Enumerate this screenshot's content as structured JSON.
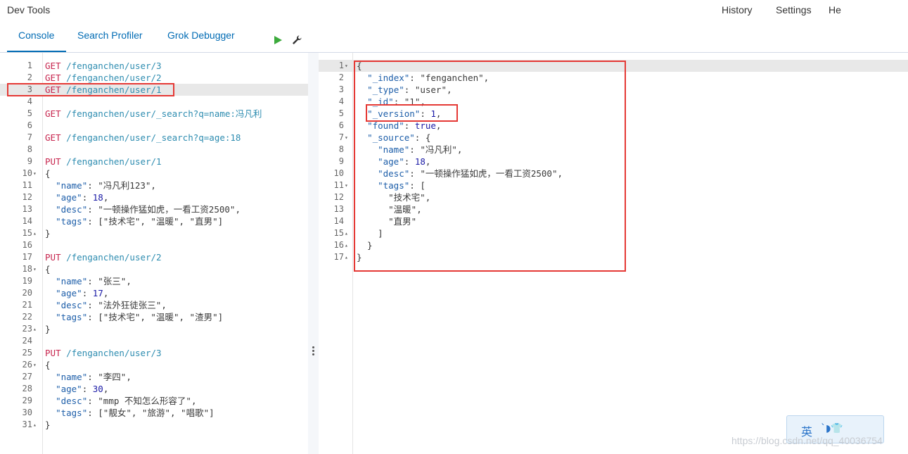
{
  "app_title": "Dev Tools",
  "top_nav": [
    "History",
    "Settings",
    "He"
  ],
  "tabs": [
    "Console",
    "Search Profiler",
    "Grok Debugger"
  ],
  "request_editor": {
    "lines": [
      {
        "n": "1",
        "fold": "",
        "tokens": [
          [
            "m",
            "GET"
          ],
          [
            "pn",
            " "
          ],
          [
            "p",
            "/fengancheen/user/3"
          ]
        ]
      },
      {
        "n": "2",
        "fold": "",
        "tokens": [
          [
            "m",
            "GET"
          ],
          [
            "pn",
            " "
          ],
          [
            "p",
            "/fenganchen/user/2"
          ]
        ]
      },
      {
        "n": "3",
        "fold": "",
        "tokens": [
          [
            "m",
            "GET"
          ],
          [
            "pn",
            " "
          ],
          [
            "p",
            "/fenganchen/user/1"
          ]
        ]
      },
      {
        "n": "4",
        "fold": "",
        "tokens": []
      },
      {
        "n": "5",
        "fold": "",
        "tokens": [
          [
            "m",
            "GET"
          ],
          [
            "pn",
            " "
          ],
          [
            "p",
            "/fenganchen/user/_search?q=name:冯凡利"
          ]
        ]
      },
      {
        "n": "6",
        "fold": "",
        "tokens": []
      },
      {
        "n": "7",
        "fold": "",
        "tokens": [
          [
            "m",
            "GET"
          ],
          [
            "pn",
            " "
          ],
          [
            "p",
            "/fenganchen/user/_search?q=age:18"
          ]
        ]
      },
      {
        "n": "8",
        "fold": "",
        "tokens": []
      },
      {
        "n": "9",
        "fold": "",
        "tokens": [
          [
            "m",
            "PUT"
          ],
          [
            "pn",
            " "
          ],
          [
            "p",
            "/fenganchen/user/1"
          ]
        ]
      },
      {
        "n": "10",
        "fold": "▾",
        "tokens": [
          [
            "pn",
            "{"
          ]
        ]
      },
      {
        "n": "11",
        "fold": "",
        "tokens": [
          [
            "pn",
            "  "
          ],
          [
            "k",
            "\"name\""
          ],
          [
            "pn",
            ": "
          ],
          [
            "s",
            "\"冯凡利123\""
          ],
          [
            "pn",
            ","
          ]
        ]
      },
      {
        "n": "12",
        "fold": "",
        "tokens": [
          [
            "pn",
            "  "
          ],
          [
            "k",
            "\"age\""
          ],
          [
            "pn",
            ": "
          ],
          [
            "n",
            "18"
          ],
          [
            "pn",
            ","
          ]
        ]
      },
      {
        "n": "13",
        "fold": "",
        "tokens": [
          [
            "pn",
            "  "
          ],
          [
            "k",
            "\"desc\""
          ],
          [
            "pn",
            ": "
          ],
          [
            "s",
            "\"一顿操作猛如虎，一看工资2500\""
          ],
          [
            "pn",
            ","
          ]
        ]
      },
      {
        "n": "14",
        "fold": "",
        "tokens": [
          [
            "pn",
            "  "
          ],
          [
            "k",
            "\"tags\""
          ],
          [
            "pn",
            ": ["
          ],
          [
            "s",
            "\"技术宅\""
          ],
          [
            "pn",
            ", "
          ],
          [
            "s",
            "\"温暖\""
          ],
          [
            "pn",
            ", "
          ],
          [
            "s",
            "\"直男\""
          ],
          [
            "pn",
            "]"
          ]
        ]
      },
      {
        "n": "15",
        "fold": "▴",
        "tokens": [
          [
            "pn",
            "}"
          ]
        ]
      },
      {
        "n": "16",
        "fold": "",
        "tokens": []
      },
      {
        "n": "17",
        "fold": "",
        "tokens": [
          [
            "m",
            "PUT"
          ],
          [
            "pn",
            " "
          ],
          [
            "p",
            "/fenganchen/user/2"
          ]
        ]
      },
      {
        "n": "18",
        "fold": "▾",
        "tokens": [
          [
            "pn",
            "{"
          ]
        ]
      },
      {
        "n": "19",
        "fold": "",
        "tokens": [
          [
            "pn",
            "  "
          ],
          [
            "k",
            "\"name\""
          ],
          [
            "pn",
            ": "
          ],
          [
            "s",
            "\"张三\""
          ],
          [
            "pn",
            ","
          ]
        ]
      },
      {
        "n": "20",
        "fold": "",
        "tokens": [
          [
            "pn",
            "  "
          ],
          [
            "k",
            "\"age\""
          ],
          [
            "pn",
            ": "
          ],
          [
            "n",
            "17"
          ],
          [
            "pn",
            ","
          ]
        ]
      },
      {
        "n": "21",
        "fold": "",
        "tokens": [
          [
            "pn",
            "  "
          ],
          [
            "k",
            "\"desc\""
          ],
          [
            "pn",
            ": "
          ],
          [
            "s",
            "\"法外狂徒张三\""
          ],
          [
            "pn",
            ","
          ]
        ]
      },
      {
        "n": "22",
        "fold": "",
        "tokens": [
          [
            "pn",
            "  "
          ],
          [
            "k",
            "\"tags\""
          ],
          [
            "pn",
            ": ["
          ],
          [
            "s",
            "\"技术宅\""
          ],
          [
            "pn",
            ", "
          ],
          [
            "s",
            "\"温暖\""
          ],
          [
            "pn",
            ", "
          ],
          [
            "s",
            "\"渣男\""
          ],
          [
            "pn",
            "]"
          ]
        ]
      },
      {
        "n": "23",
        "fold": "▴",
        "tokens": [
          [
            "pn",
            "}"
          ]
        ]
      },
      {
        "n": "24",
        "fold": "",
        "tokens": []
      },
      {
        "n": "25",
        "fold": "",
        "tokens": [
          [
            "m",
            "PUT"
          ],
          [
            "pn",
            " "
          ],
          [
            "p",
            "/fenganchen/user/3"
          ]
        ]
      },
      {
        "n": "26",
        "fold": "▾",
        "tokens": [
          [
            "pn",
            "{"
          ]
        ]
      },
      {
        "n": "27",
        "fold": "",
        "tokens": [
          [
            "pn",
            "  "
          ],
          [
            "k",
            "\"name\""
          ],
          [
            "pn",
            ": "
          ],
          [
            "s",
            "\"李四\""
          ],
          [
            "pn",
            ","
          ]
        ]
      },
      {
        "n": "28",
        "fold": "",
        "tokens": [
          [
            "pn",
            "  "
          ],
          [
            "k",
            "\"age\""
          ],
          [
            "pn",
            ": "
          ],
          [
            "n",
            "30"
          ],
          [
            "pn",
            ","
          ]
        ]
      },
      {
        "n": "29",
        "fold": "",
        "tokens": [
          [
            "pn",
            "  "
          ],
          [
            "k",
            "\"desc\""
          ],
          [
            "pn",
            ": "
          ],
          [
            "s",
            "\"mmp 不知怎么形容了\""
          ],
          [
            "pn",
            ","
          ]
        ]
      },
      {
        "n": "30",
        "fold": "",
        "tokens": [
          [
            "pn",
            "  "
          ],
          [
            "k",
            "\"tags\""
          ],
          [
            "pn",
            ": ["
          ],
          [
            "s",
            "\"靓女\""
          ],
          [
            "pn",
            ", "
          ],
          [
            "s",
            "\"旅游\""
          ],
          [
            "pn",
            ", "
          ],
          [
            "s",
            "\"唱歌\""
          ],
          [
            "pn",
            "]"
          ]
        ]
      },
      {
        "n": "31",
        "fold": "▴",
        "tokens": [
          [
            "pn",
            "}"
          ]
        ]
      }
    ]
  },
  "response_editor": {
    "lines": [
      {
        "n": "1",
        "fold": "▾",
        "tokens": [
          [
            "pn",
            "{"
          ]
        ]
      },
      {
        "n": "2",
        "fold": "",
        "tokens": [
          [
            "pn",
            "  "
          ],
          [
            "k",
            "\"_index\""
          ],
          [
            "pn",
            ": "
          ],
          [
            "s",
            "\"fenganchen\""
          ],
          [
            "pn",
            ","
          ]
        ]
      },
      {
        "n": "3",
        "fold": "",
        "tokens": [
          [
            "pn",
            "  "
          ],
          [
            "k",
            "\"_type\""
          ],
          [
            "pn",
            ": "
          ],
          [
            "s",
            "\"user\""
          ],
          [
            "pn",
            ","
          ]
        ]
      },
      {
        "n": "4",
        "fold": "",
        "tokens": [
          [
            "pn",
            "  "
          ],
          [
            "k",
            "\"_id\""
          ],
          [
            "pn",
            ": "
          ],
          [
            "s",
            "\"1\""
          ],
          [
            "pn",
            ","
          ]
        ]
      },
      {
        "n": "5",
        "fold": "",
        "tokens": [
          [
            "pn",
            "  "
          ],
          [
            "k",
            "\"_version\""
          ],
          [
            "pn",
            ": "
          ],
          [
            "n",
            "1"
          ],
          [
            "pn",
            ","
          ]
        ]
      },
      {
        "n": "6",
        "fold": "",
        "tokens": [
          [
            "pn",
            "  "
          ],
          [
            "k",
            "\"found\""
          ],
          [
            "pn",
            ": "
          ],
          [
            "b",
            "true"
          ],
          [
            "pn",
            ","
          ]
        ]
      },
      {
        "n": "7",
        "fold": "▾",
        "tokens": [
          [
            "pn",
            "  "
          ],
          [
            "k",
            "\"_source\""
          ],
          [
            "pn",
            ": {"
          ]
        ]
      },
      {
        "n": "8",
        "fold": "",
        "tokens": [
          [
            "pn",
            "    "
          ],
          [
            "k",
            "\"name\""
          ],
          [
            "pn",
            ": "
          ],
          [
            "s",
            "\"冯凡利\""
          ],
          [
            "pn",
            ","
          ]
        ]
      },
      {
        "n": "9",
        "fold": "",
        "tokens": [
          [
            "pn",
            "    "
          ],
          [
            "k",
            "\"age\""
          ],
          [
            "pn",
            ": "
          ],
          [
            "n",
            "18"
          ],
          [
            "pn",
            ","
          ]
        ]
      },
      {
        "n": "10",
        "fold": "",
        "tokens": [
          [
            "pn",
            "    "
          ],
          [
            "k",
            "\"desc\""
          ],
          [
            "pn",
            ": "
          ],
          [
            "s",
            "\"一顿操作猛如虎，一看工资2500\""
          ],
          [
            "pn",
            ","
          ]
        ]
      },
      {
        "n": "11",
        "fold": "▾",
        "tokens": [
          [
            "pn",
            "    "
          ],
          [
            "k",
            "\"tags\""
          ],
          [
            "pn",
            ": ["
          ]
        ]
      },
      {
        "n": "12",
        "fold": "",
        "tokens": [
          [
            "pn",
            "      "
          ],
          [
            "s",
            "\"技术宅\""
          ],
          [
            "pn",
            ","
          ]
        ]
      },
      {
        "n": "13",
        "fold": "",
        "tokens": [
          [
            "pn",
            "      "
          ],
          [
            "s",
            "\"温暖\""
          ],
          [
            "pn",
            ","
          ]
        ]
      },
      {
        "n": "14",
        "fold": "",
        "tokens": [
          [
            "pn",
            "      "
          ],
          [
            "s",
            "\"直男\""
          ]
        ]
      },
      {
        "n": "15",
        "fold": "▴",
        "tokens": [
          [
            "pn",
            "    ]"
          ]
        ]
      },
      {
        "n": "16",
        "fold": "▴",
        "tokens": [
          [
            "pn",
            "  }"
          ]
        ]
      },
      {
        "n": "17",
        "fold": "▴",
        "tokens": [
          [
            "pn",
            "}"
          ]
        ]
      }
    ]
  },
  "ime_widget": {
    "label": "英",
    "icons": "ˋ◗👕"
  },
  "watermark": "https://blog.csdn.net/qq_40036754"
}
